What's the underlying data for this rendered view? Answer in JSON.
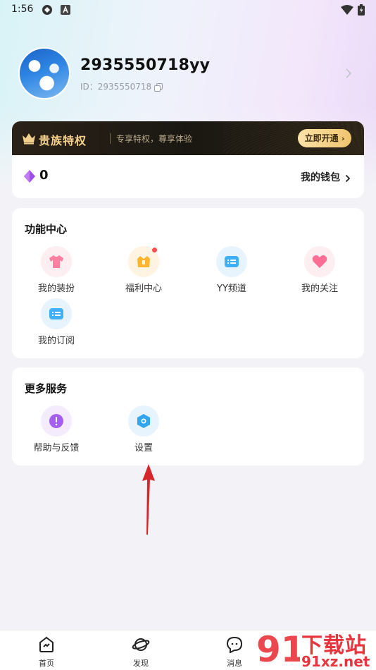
{
  "status_bar": {
    "time": "1:56"
  },
  "profile": {
    "username": "2935550718yy",
    "id_text": "ID：2935550718"
  },
  "vip": {
    "title": "贵族特权",
    "subtitle": "专享特权，尊享体验",
    "button": "立即开通"
  },
  "wallet": {
    "gem_count": "0",
    "link": "我的钱包"
  },
  "function_center": {
    "title": "功能中心",
    "items": [
      {
        "label": "我的装扮",
        "icon": "clothes-icon"
      },
      {
        "label": "福利中心",
        "icon": "gift-icon"
      },
      {
        "label": "YY频道",
        "icon": "channel-icon"
      },
      {
        "label": "我的关注",
        "icon": "heart-icon"
      },
      {
        "label": "我的订阅",
        "icon": "subscribe-icon"
      }
    ]
  },
  "more_services": {
    "title": "更多服务",
    "items": [
      {
        "label": "帮助与反馈",
        "icon": "help-icon"
      },
      {
        "label": "设置",
        "icon": "settings-icon"
      }
    ]
  },
  "bottom_nav": {
    "items": [
      {
        "label": "首页",
        "icon": "home-icon"
      },
      {
        "label": "发现",
        "icon": "planet-icon"
      },
      {
        "label": "消息",
        "icon": "message-icon"
      }
    ]
  },
  "watermark": {
    "logo": "91",
    "text": "下载站",
    "url": "91xz.net"
  },
  "colors": {
    "vip_gold": "#f2cf8a",
    "accent_red": "#e8343c",
    "arrow_red": "#d6262b"
  }
}
